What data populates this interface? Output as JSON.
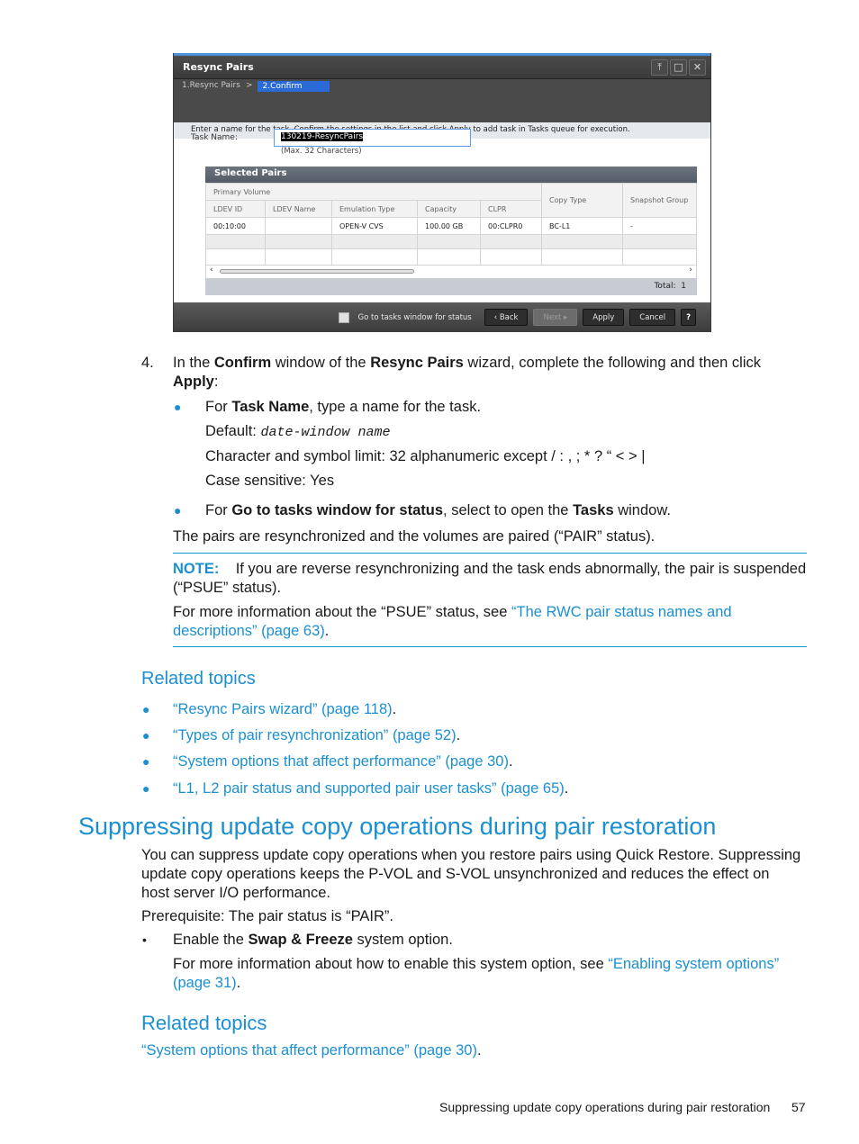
{
  "window": {
    "title": "Resync Pairs",
    "controls": [
      "pin-icon",
      "maximize-icon",
      "close-icon"
    ],
    "steps": [
      "1.Resync Pairs",
      ">",
      "2.Confirm"
    ],
    "instruction": "Enter a name for the task. Confirm the settings in the list and click Apply to add task in Tasks queue for execution.",
    "task_name_label": "Task Name:",
    "task_name_value": "130219-ResyncPairs",
    "task_name_hint": "(Max. 32 Characters)",
    "selected_pairs_title": "Selected Pairs",
    "table": {
      "group_header": "Primary Volume",
      "columns": [
        "LDEV ID",
        "LDEV Name",
        "Emulation Type",
        "Capacity",
        "CLPR",
        "Copy Type",
        "Snapshot Group"
      ],
      "rows": [
        [
          "00:10:00",
          "",
          "OPEN-V CVS",
          "100.00 GB",
          "00:CLPR0",
          "BC-L1",
          "-"
        ]
      ]
    },
    "total_label": "Total:",
    "total_value": "1",
    "footer": {
      "checkbox_label": "Go to tasks window for status",
      "checkbox_checked": false,
      "back": "Back",
      "next": "Next",
      "apply": "Apply",
      "cancel": "Cancel",
      "help": "?"
    }
  },
  "step4": {
    "number": "4.",
    "t1": "In the ",
    "b1": "Confirm",
    "t2": " window of the ",
    "b2": "Resync Pairs",
    "t3": " wizard, complete the following and then click",
    "b3": "Apply",
    "t4": ":",
    "bullet1": {
      "t1": "For ",
      "b1": "Task Name",
      "t2": ", type a name for the task."
    },
    "default_label": "Default: ",
    "default_value": "date-window name",
    "char_limit": "Character and symbol limit: 32 alphanumeric except / : , ; * ? “ < > |",
    "case_sensitive": "Case sensitive: Yes",
    "bullet2": {
      "t1": "For ",
      "b1": "Go to tasks window for status",
      "t2": ", select to open the ",
      "b2": "Tasks",
      "t3": " window."
    },
    "result": "The pairs are resynchronized and the volumes are paired (“PAIR” status)."
  },
  "note": {
    "label": "NOTE:",
    "line1": "If you are reverse resynchronizing and the task ends abnormally, the pair is suspended",
    "line2": "(“PSUE” status).",
    "more_prefix": "For more information about the “PSUE” status, see ",
    "link1": "“The RWC pair status names and",
    "link2": "descriptions” (page 63)",
    "suffix": "."
  },
  "related1": {
    "heading": "Related topics",
    "items": [
      "“Resync Pairs wizard” (page 118)",
      "“Types of pair resynchronization” (page 52)",
      "“System options that affect performance” (page 30)",
      "“L1, L2 pair status and supported pair user tasks” (page 65)"
    ]
  },
  "section": {
    "title": "Suppressing update copy operations during pair restoration",
    "para1": "You can suppress update copy operations when you restore pairs using Quick Restore. Suppressing",
    "para2": "update copy operations keeps the P-VOL and S-VOL unsynchronized and reduces the effect on",
    "para3": "host server I/O performance.",
    "prereq": "Prerequisite: The pair status is “PAIR”.",
    "bullet": {
      "t1": "Enable the ",
      "b1": "Swap & Freeze",
      "t2": " system option."
    },
    "more_prefix": "For more information about how to enable this system option, see ",
    "link1": "“Enabling system options”",
    "link2": "(page 31)",
    "suffix": "."
  },
  "related2": {
    "heading": "Related topics",
    "item": "“System options that affect performance” (page 30)",
    "suffix": "."
  },
  "footer": {
    "title": "Suppressing update copy operations during pair restoration",
    "page": "57"
  }
}
